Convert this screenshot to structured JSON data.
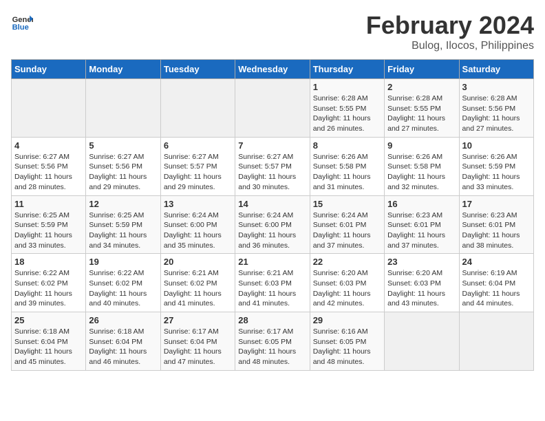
{
  "logo": {
    "text_general": "General",
    "text_blue": "Blue"
  },
  "title": "February 2024",
  "subtitle": "Bulog, Ilocos, Philippines",
  "days_of_week": [
    "Sunday",
    "Monday",
    "Tuesday",
    "Wednesday",
    "Thursday",
    "Friday",
    "Saturday"
  ],
  "weeks": [
    [
      {
        "day": "",
        "info": ""
      },
      {
        "day": "",
        "info": ""
      },
      {
        "day": "",
        "info": ""
      },
      {
        "day": "",
        "info": ""
      },
      {
        "day": "1",
        "info": "Sunrise: 6:28 AM\nSunset: 5:55 PM\nDaylight: 11 hours and 26 minutes."
      },
      {
        "day": "2",
        "info": "Sunrise: 6:28 AM\nSunset: 5:55 PM\nDaylight: 11 hours and 27 minutes."
      },
      {
        "day": "3",
        "info": "Sunrise: 6:28 AM\nSunset: 5:56 PM\nDaylight: 11 hours and 27 minutes."
      }
    ],
    [
      {
        "day": "4",
        "info": "Sunrise: 6:27 AM\nSunset: 5:56 PM\nDaylight: 11 hours and 28 minutes."
      },
      {
        "day": "5",
        "info": "Sunrise: 6:27 AM\nSunset: 5:56 PM\nDaylight: 11 hours and 29 minutes."
      },
      {
        "day": "6",
        "info": "Sunrise: 6:27 AM\nSunset: 5:57 PM\nDaylight: 11 hours and 29 minutes."
      },
      {
        "day": "7",
        "info": "Sunrise: 6:27 AM\nSunset: 5:57 PM\nDaylight: 11 hours and 30 minutes."
      },
      {
        "day": "8",
        "info": "Sunrise: 6:26 AM\nSunset: 5:58 PM\nDaylight: 11 hours and 31 minutes."
      },
      {
        "day": "9",
        "info": "Sunrise: 6:26 AM\nSunset: 5:58 PM\nDaylight: 11 hours and 32 minutes."
      },
      {
        "day": "10",
        "info": "Sunrise: 6:26 AM\nSunset: 5:59 PM\nDaylight: 11 hours and 33 minutes."
      }
    ],
    [
      {
        "day": "11",
        "info": "Sunrise: 6:25 AM\nSunset: 5:59 PM\nDaylight: 11 hours and 33 minutes."
      },
      {
        "day": "12",
        "info": "Sunrise: 6:25 AM\nSunset: 5:59 PM\nDaylight: 11 hours and 34 minutes."
      },
      {
        "day": "13",
        "info": "Sunrise: 6:24 AM\nSunset: 6:00 PM\nDaylight: 11 hours and 35 minutes."
      },
      {
        "day": "14",
        "info": "Sunrise: 6:24 AM\nSunset: 6:00 PM\nDaylight: 11 hours and 36 minutes."
      },
      {
        "day": "15",
        "info": "Sunrise: 6:24 AM\nSunset: 6:01 PM\nDaylight: 11 hours and 37 minutes."
      },
      {
        "day": "16",
        "info": "Sunrise: 6:23 AM\nSunset: 6:01 PM\nDaylight: 11 hours and 37 minutes."
      },
      {
        "day": "17",
        "info": "Sunrise: 6:23 AM\nSunset: 6:01 PM\nDaylight: 11 hours and 38 minutes."
      }
    ],
    [
      {
        "day": "18",
        "info": "Sunrise: 6:22 AM\nSunset: 6:02 PM\nDaylight: 11 hours and 39 minutes."
      },
      {
        "day": "19",
        "info": "Sunrise: 6:22 AM\nSunset: 6:02 PM\nDaylight: 11 hours and 40 minutes."
      },
      {
        "day": "20",
        "info": "Sunrise: 6:21 AM\nSunset: 6:02 PM\nDaylight: 11 hours and 41 minutes."
      },
      {
        "day": "21",
        "info": "Sunrise: 6:21 AM\nSunset: 6:03 PM\nDaylight: 11 hours and 41 minutes."
      },
      {
        "day": "22",
        "info": "Sunrise: 6:20 AM\nSunset: 6:03 PM\nDaylight: 11 hours and 42 minutes."
      },
      {
        "day": "23",
        "info": "Sunrise: 6:20 AM\nSunset: 6:03 PM\nDaylight: 11 hours and 43 minutes."
      },
      {
        "day": "24",
        "info": "Sunrise: 6:19 AM\nSunset: 6:04 PM\nDaylight: 11 hours and 44 minutes."
      }
    ],
    [
      {
        "day": "25",
        "info": "Sunrise: 6:18 AM\nSunset: 6:04 PM\nDaylight: 11 hours and 45 minutes."
      },
      {
        "day": "26",
        "info": "Sunrise: 6:18 AM\nSunset: 6:04 PM\nDaylight: 11 hours and 46 minutes."
      },
      {
        "day": "27",
        "info": "Sunrise: 6:17 AM\nSunset: 6:04 PM\nDaylight: 11 hours and 47 minutes."
      },
      {
        "day": "28",
        "info": "Sunrise: 6:17 AM\nSunset: 6:05 PM\nDaylight: 11 hours and 48 minutes."
      },
      {
        "day": "29",
        "info": "Sunrise: 6:16 AM\nSunset: 6:05 PM\nDaylight: 11 hours and 48 minutes."
      },
      {
        "day": "",
        "info": ""
      },
      {
        "day": "",
        "info": ""
      }
    ]
  ]
}
